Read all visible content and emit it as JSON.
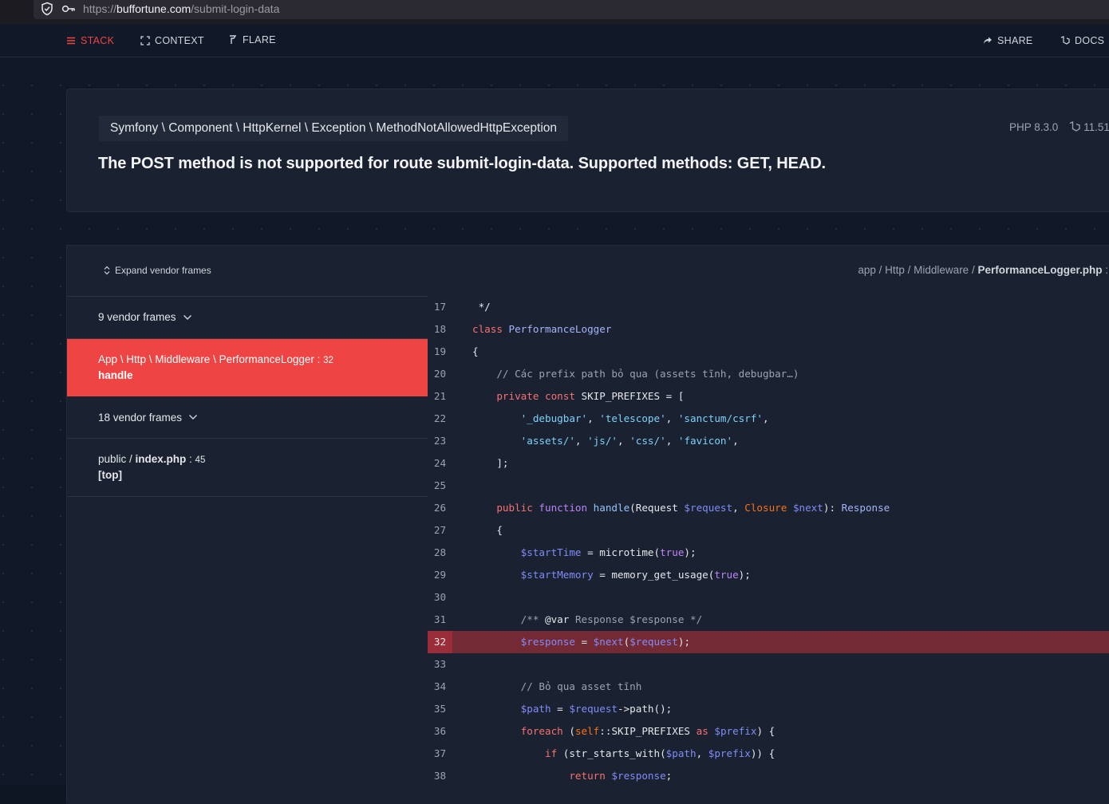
{
  "browser": {
    "url_scheme": "https://",
    "url_host": "buffortune.com",
    "url_path": "/submit-login-data"
  },
  "nav": {
    "stack": "STACK",
    "context": "CONTEXT",
    "flare": "FLARE",
    "share": "SHARE",
    "docs": "DOCS"
  },
  "exception": {
    "class": "Symfony \\ Component \\ HttpKernel \\ Exception \\ MethodNotAllowedHttpException",
    "message": "The POST method is not supported for route submit-login-data. Supported methods: GET, HEAD.",
    "php_version": "PHP 8.3.0",
    "laravel_version": "11.51"
  },
  "frames": {
    "expand_label": "Expand vendor frames",
    "items": [
      {
        "type": "vendor",
        "label": "9 vendor frames"
      },
      {
        "type": "app",
        "path": "App \\ Http \\ Middleware \\ PerformanceLogger",
        "line": "32",
        "function": "handle",
        "active": true
      },
      {
        "type": "vendor",
        "label": "18 vendor frames"
      },
      {
        "type": "app",
        "path_prefix": "public / ",
        "path_file": "index.php",
        "line": "45",
        "function": "[top]",
        "active": false
      }
    ]
  },
  "code": {
    "path_prefix": "app / Http / Middleware / ",
    "file": "PerformanceLogger.php",
    "suffix": " :",
    "highlight_line": 32,
    "lines": [
      {
        "n": 17,
        "tokens": [
          [
            " */",
            ""
          ]
        ]
      },
      {
        "n": 18,
        "tokens": [
          [
            "class ",
            "k"
          ],
          [
            "PerformanceLogger",
            "cls"
          ]
        ]
      },
      {
        "n": 19,
        "tokens": [
          [
            "{",
            ""
          ]
        ]
      },
      {
        "n": 20,
        "tokens": [
          [
            "    // Các prefix path bỏ qua (assets tĩnh, debugbar…)",
            "cm"
          ]
        ]
      },
      {
        "n": 21,
        "tokens": [
          [
            "    ",
            ""
          ],
          [
            "private const ",
            "k"
          ],
          [
            "SKIP_PREFIXES = [",
            ""
          ]
        ]
      },
      {
        "n": 22,
        "tokens": [
          [
            "        ",
            ""
          ],
          [
            "'_debugbar'",
            "str"
          ],
          [
            ", ",
            ""
          ],
          [
            "'telescope'",
            "str"
          ],
          [
            ", ",
            ""
          ],
          [
            "'sanctum/csrf'",
            "str"
          ],
          [
            ",",
            ""
          ]
        ]
      },
      {
        "n": 23,
        "tokens": [
          [
            "        ",
            ""
          ],
          [
            "'assets/'",
            "str"
          ],
          [
            ", ",
            ""
          ],
          [
            "'js/'",
            "str"
          ],
          [
            ", ",
            ""
          ],
          [
            "'css/'",
            "str"
          ],
          [
            ", ",
            ""
          ],
          [
            "'favicon'",
            "str"
          ],
          [
            ",",
            ""
          ]
        ]
      },
      {
        "n": 24,
        "tokens": [
          [
            "    ];",
            ""
          ]
        ]
      },
      {
        "n": 25,
        "tokens": [
          [
            "",
            ""
          ]
        ]
      },
      {
        "n": 26,
        "tokens": [
          [
            "    ",
            ""
          ],
          [
            "public ",
            "k"
          ],
          [
            "function ",
            "k2"
          ],
          [
            "handle",
            "fn"
          ],
          [
            "(Request ",
            ""
          ],
          [
            "$request",
            "var"
          ],
          [
            ", ",
            ""
          ],
          [
            "Closure ",
            "org"
          ],
          [
            "$next",
            "var"
          ],
          [
            "): ",
            ""
          ],
          [
            "Response",
            "cls"
          ]
        ]
      },
      {
        "n": 27,
        "tokens": [
          [
            "    {",
            ""
          ]
        ]
      },
      {
        "n": 28,
        "tokens": [
          [
            "        ",
            ""
          ],
          [
            "$startTime",
            "var"
          ],
          [
            " = microtime(",
            ""
          ],
          [
            "true",
            "k2"
          ],
          [
            ");",
            ""
          ]
        ]
      },
      {
        "n": 29,
        "tokens": [
          [
            "        ",
            ""
          ],
          [
            "$startMemory",
            "var"
          ],
          [
            " = memory_get_usage(",
            ""
          ],
          [
            "true",
            "k2"
          ],
          [
            ");",
            ""
          ]
        ]
      },
      {
        "n": 30,
        "tokens": [
          [
            "",
            ""
          ]
        ]
      },
      {
        "n": 31,
        "tokens": [
          [
            "        ",
            ""
          ],
          [
            "/** ",
            "cm"
          ],
          [
            "@var",
            ""
          ],
          [
            " Response $response */",
            "cm"
          ]
        ]
      },
      {
        "n": 32,
        "tokens": [
          [
            "        ",
            ""
          ],
          [
            "$response",
            "var"
          ],
          [
            " = ",
            ""
          ],
          [
            "$next",
            "var"
          ],
          [
            "(",
            ""
          ],
          [
            "$request",
            "var"
          ],
          [
            ");",
            ""
          ]
        ]
      },
      {
        "n": 33,
        "tokens": [
          [
            "",
            ""
          ]
        ]
      },
      {
        "n": 34,
        "tokens": [
          [
            "        // Bỏ qua asset tĩnh",
            "cm"
          ]
        ]
      },
      {
        "n": 35,
        "tokens": [
          [
            "        ",
            ""
          ],
          [
            "$path",
            "var"
          ],
          [
            " = ",
            ""
          ],
          [
            "$request",
            "var"
          ],
          [
            "->path();",
            ""
          ]
        ]
      },
      {
        "n": 36,
        "tokens": [
          [
            "        ",
            ""
          ],
          [
            "foreach ",
            "k"
          ],
          [
            "(",
            ""
          ],
          [
            "self",
            "org"
          ],
          [
            "::SKIP_PREFIXES ",
            ""
          ],
          [
            "as ",
            "k"
          ],
          [
            "$prefix",
            "var"
          ],
          [
            ") {",
            ""
          ]
        ]
      },
      {
        "n": 37,
        "tokens": [
          [
            "            ",
            ""
          ],
          [
            "if ",
            "k"
          ],
          [
            "(str_starts_with(",
            ""
          ],
          [
            "$path",
            "var"
          ],
          [
            ", ",
            ""
          ],
          [
            "$prefix",
            "var"
          ],
          [
            ")) {",
            ""
          ]
        ]
      },
      {
        "n": 38,
        "tokens": [
          [
            "                ",
            ""
          ],
          [
            "return ",
            "k"
          ],
          [
            "$response",
            "var"
          ],
          [
            ";",
            ""
          ]
        ]
      }
    ]
  }
}
